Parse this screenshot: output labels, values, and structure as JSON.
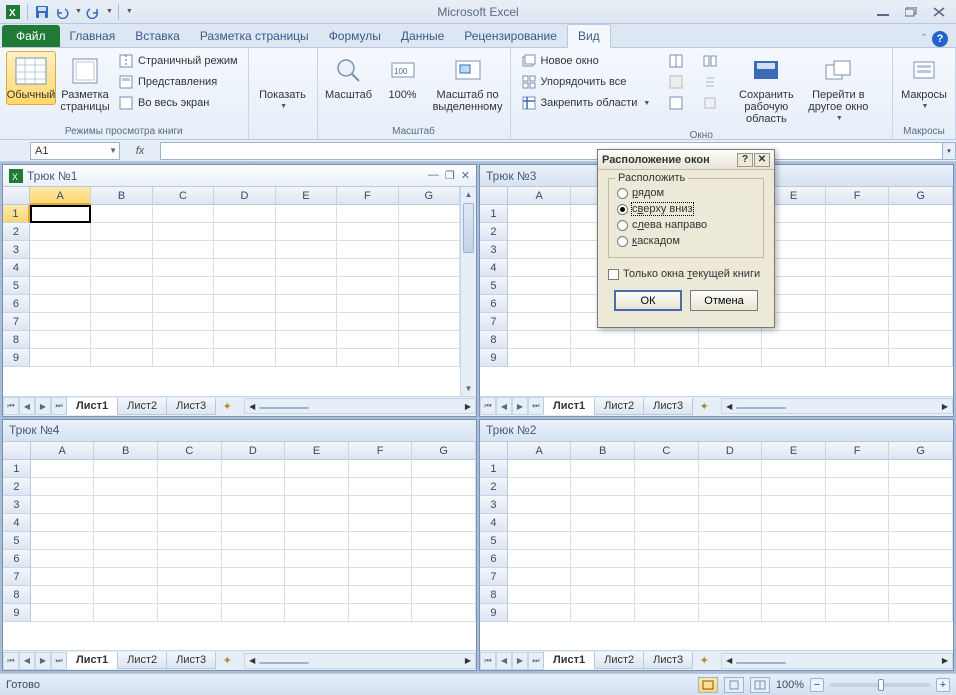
{
  "app_title": "Microsoft Excel",
  "qat": {
    "save": "save-icon",
    "undo": "undo-icon",
    "redo": "redo-icon"
  },
  "tabs": {
    "file": "Файл",
    "items": [
      "Главная",
      "Вставка",
      "Разметка страницы",
      "Формулы",
      "Данные",
      "Рецензирование",
      "Вид"
    ],
    "active": "Вид"
  },
  "ribbon": {
    "group_views": {
      "label": "Режимы просмотра книги",
      "normal": "Обычный",
      "page_layout": "Разметка страницы",
      "page_break": "Страничный режим",
      "custom_views": "Представления",
      "fullscreen": "Во весь экран"
    },
    "group_show": {
      "btn": "Показать"
    },
    "group_zoom": {
      "label": "Масштаб",
      "zoom": "Масштаб",
      "z100": "100%",
      "zoom_sel": "Масштаб по выделенному"
    },
    "group_window": {
      "label": "Окно",
      "new_win": "Новое окно",
      "arrange": "Упорядочить все",
      "freeze": "Закрепить области",
      "save_ws": "Сохранить рабочую область",
      "switch": "Перейти в другое окно"
    },
    "group_macros": {
      "label": "Макросы",
      "btn": "Макросы"
    }
  },
  "formula_bar": {
    "name_box": "A1",
    "fx": "fx"
  },
  "workbooks": [
    {
      "title": "Трюк №1",
      "active": true,
      "has_win_ctrls": true
    },
    {
      "title": "Трюк №3",
      "active": false,
      "has_win_ctrls": false
    },
    {
      "title": "Трюк №4",
      "active": false,
      "has_win_ctrls": false
    },
    {
      "title": "Трюк №2",
      "active": false,
      "has_win_ctrls": false
    }
  ],
  "columns": [
    "A",
    "B",
    "C",
    "D",
    "E",
    "F",
    "G"
  ],
  "row_count": 9,
  "sheets": [
    "Лист1",
    "Лист2",
    "Лист3"
  ],
  "active_sheet": "Лист1",
  "dialog": {
    "title": "Расположение окон",
    "group": "Расположить",
    "options": [
      {
        "label": "рядом",
        "ul": "р",
        "checked": false
      },
      {
        "label": "сверху вниз",
        "ul": "в",
        "checked": true
      },
      {
        "label": "слева направо",
        "ul": "л",
        "checked": false
      },
      {
        "label": "каскадом",
        "ul": "к",
        "checked": false
      }
    ],
    "checkbox": "Только окна текущей книги",
    "checkbox_ul": "т",
    "ok": "ОК",
    "cancel": "Отмена"
  },
  "statusbar": {
    "ready": "Готово",
    "zoom": "100%"
  }
}
